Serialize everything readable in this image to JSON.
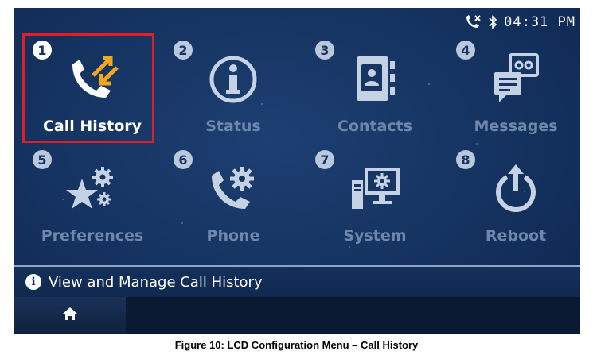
{
  "status_bar": {
    "clock": "04:31 PM",
    "icons": [
      "missed-call-icon",
      "bluetooth-icon"
    ]
  },
  "menu": {
    "selected_index": 0,
    "tiles": [
      {
        "number": "1",
        "label": "Call History",
        "icon": "call-history-icon"
      },
      {
        "number": "2",
        "label": "Status",
        "icon": "status-info-icon"
      },
      {
        "number": "3",
        "label": "Contacts",
        "icon": "contacts-icon"
      },
      {
        "number": "4",
        "label": "Messages",
        "icon": "messages-icon"
      },
      {
        "number": "5",
        "label": "Preferences",
        "icon": "preferences-icon"
      },
      {
        "number": "6",
        "label": "Phone",
        "icon": "phone-settings-icon"
      },
      {
        "number": "7",
        "label": "System",
        "icon": "system-icon"
      },
      {
        "number": "8",
        "label": "Reboot",
        "icon": "reboot-icon"
      }
    ]
  },
  "info_bar": {
    "text": "View and Manage Call History",
    "icon": "info-icon"
  },
  "softkeys": {
    "home_icon": "home-icon"
  },
  "caption": "Figure 10: LCD Configuration Menu – Call History",
  "colors": {
    "screen_bg": "#163563",
    "highlight": "#e01e26",
    "dim_label": "#6e88ac",
    "arrow_accent": "#f2a81d"
  }
}
